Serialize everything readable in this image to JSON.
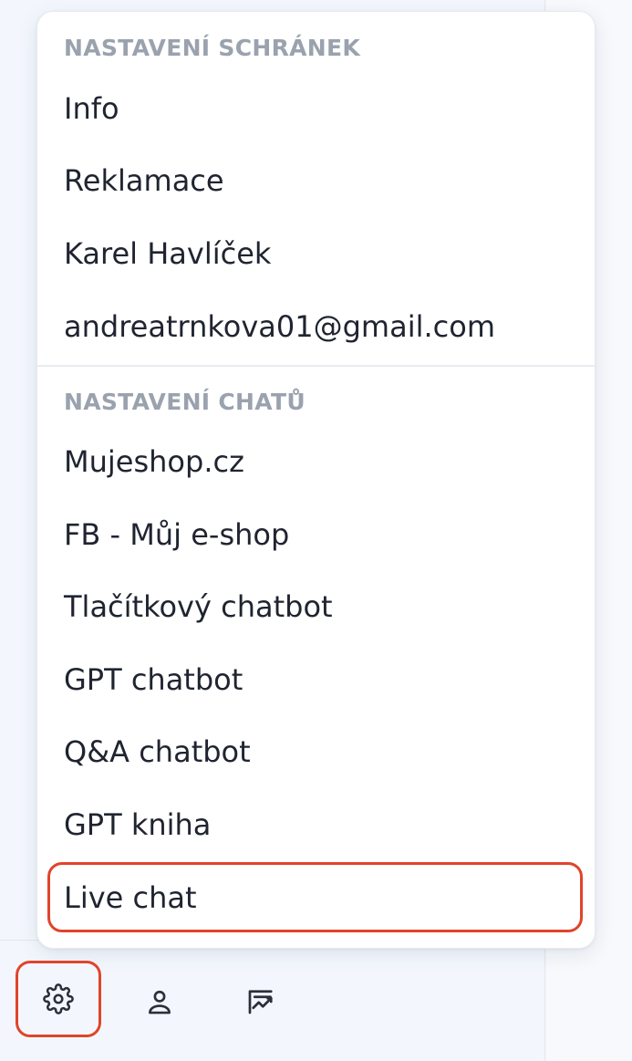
{
  "menu": {
    "mailbox_section": {
      "header": "NASTAVENÍ SCHRÁNEK",
      "items": [
        "Info",
        "Reklamace",
        "Karel Havlíček",
        "andreatrnkova01@gmail.com"
      ]
    },
    "chat_section": {
      "header": "NASTAVENÍ CHATŮ",
      "items": [
        "Mujeshop.cz",
        "FB - Můj e-shop",
        "Tlačítkový chatbot",
        "GPT chatbot",
        "Q&A chatbot",
        "GPT kniha",
        "Live chat"
      ]
    }
  },
  "toolbar": {
    "icons": [
      "gear-icon",
      "person-icon",
      "chart-icon"
    ]
  },
  "colors": {
    "highlight": "#e0442b",
    "text": "#1f2430",
    "section_header": "#9aa2ae",
    "background": "#f3f7fd"
  }
}
